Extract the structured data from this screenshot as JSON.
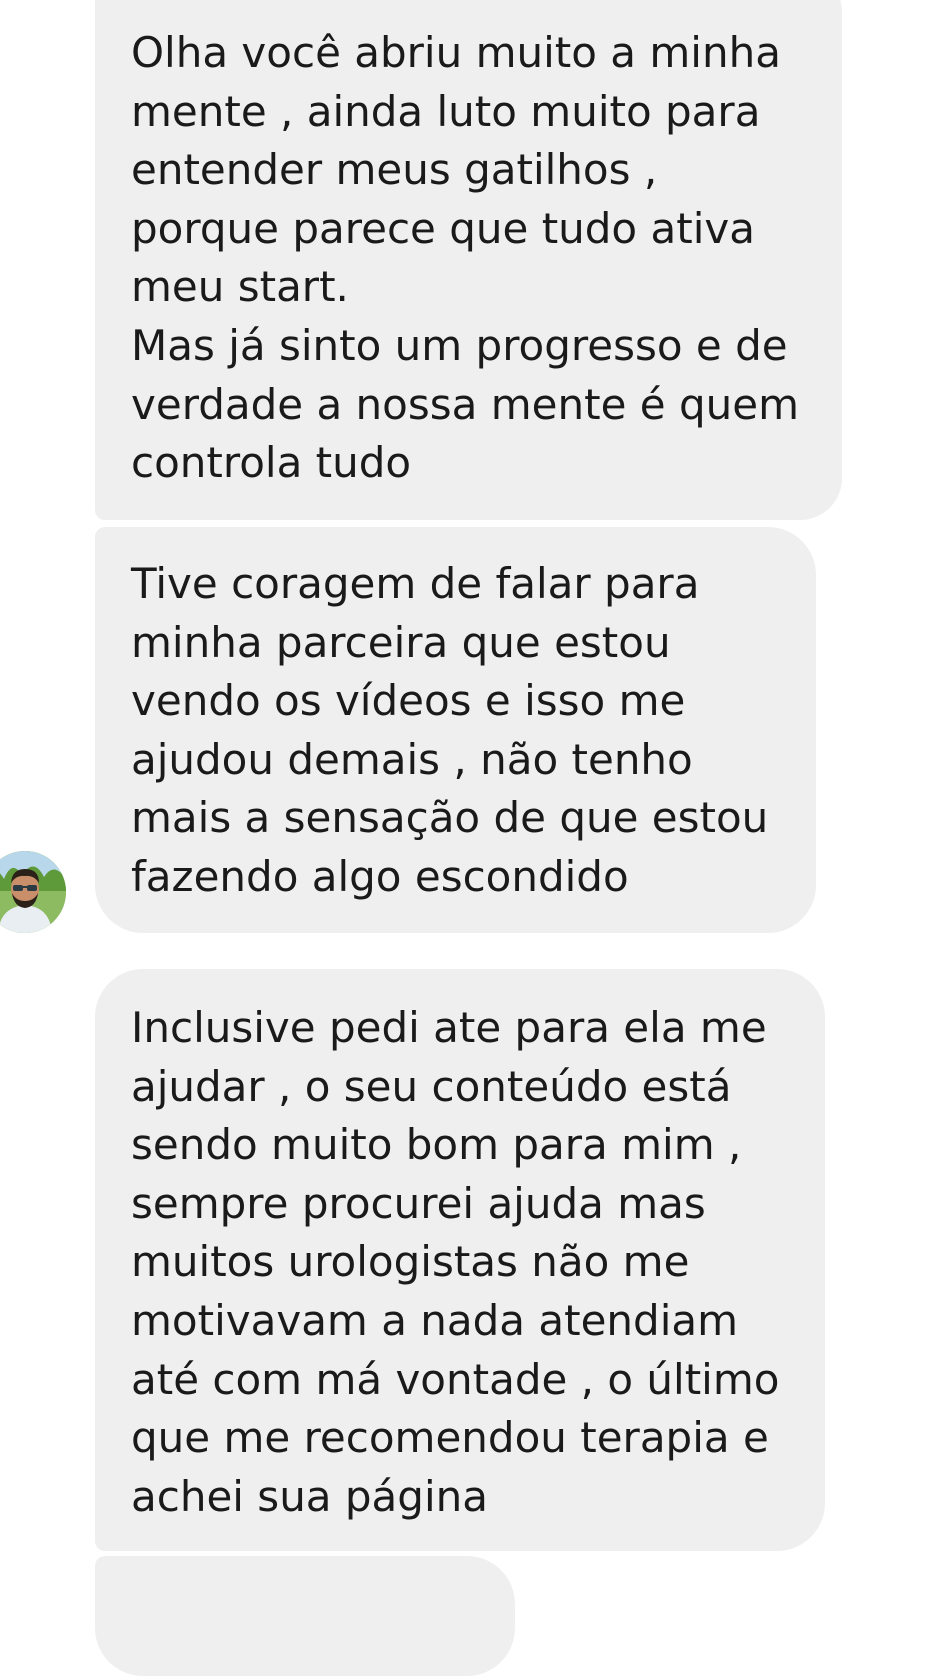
{
  "messages": [
    {
      "lines": [
        "Olha você abriu muito a minha",
        "mente , ainda luto muito para",
        "entender meus gatilhos ,",
        "porque parece que tudo ativa",
        "meu start.",
        "Mas já sinto um progresso e de",
        "verdade a nossa mente é quem",
        "controla tudo"
      ]
    },
    {
      "lines": [
        "Tive coragem de falar para",
        "minha parceira que estou",
        "vendo os vídeos e isso me",
        "ajudou demais , não tenho",
        "mais a sensação de que estou",
        "fazendo algo escondido"
      ]
    },
    {
      "lines": [
        "Inclusive pedi ate para ela me",
        "ajudar , o seu conteúdo está",
        "sendo muito bom para mim ,",
        "sempre procurei ajuda mas",
        "muitos urologistas não me",
        "motivavam a nada atendiam",
        "até com má vontade , o último",
        "que me recomendou terapia e",
        "achei sua página"
      ]
    }
  ],
  "sender": {
    "avatar_icon": "user-avatar-photo"
  },
  "colors": {
    "bubble_background": "#efefef",
    "text": "#1a1a1a",
    "page_background": "#ffffff"
  }
}
